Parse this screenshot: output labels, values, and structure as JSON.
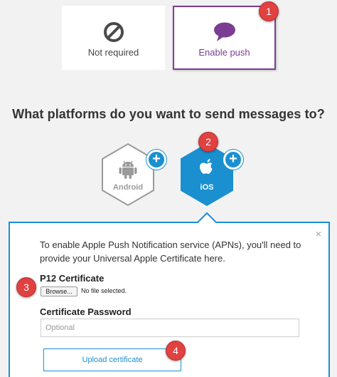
{
  "push_options": {
    "not_required_label": "Not required",
    "enable_push_label": "Enable push"
  },
  "steps": {
    "step1": "1",
    "step2": "2",
    "step3": "3",
    "step4": "4"
  },
  "question": "What platforms do you want to send messages to?",
  "platforms": {
    "android_label": "Android",
    "ios_label": "iOS",
    "add_symbol": "+"
  },
  "panel": {
    "close_symbol": "×",
    "description": "To enable Apple Push Notification service (APNs), you'll need to provide your Universal Apple Certificate here.",
    "p12_label": "P12 Certificate",
    "browse_label": "Browse...",
    "file_status": "No file selected.",
    "password_label": "Certificate Password",
    "password_placeholder": "Optional",
    "upload_label": "Upload certificate"
  },
  "colors": {
    "accent_purple": "#7b3d92",
    "accent_blue": "#1a90d1",
    "step_red": "#e04141",
    "android_gray": "#9a9a9a"
  },
  "icons": {
    "not_required": "ban-icon",
    "enable_push": "speech-bubble-icon",
    "android": "android-icon",
    "ios": "apple-icon"
  }
}
